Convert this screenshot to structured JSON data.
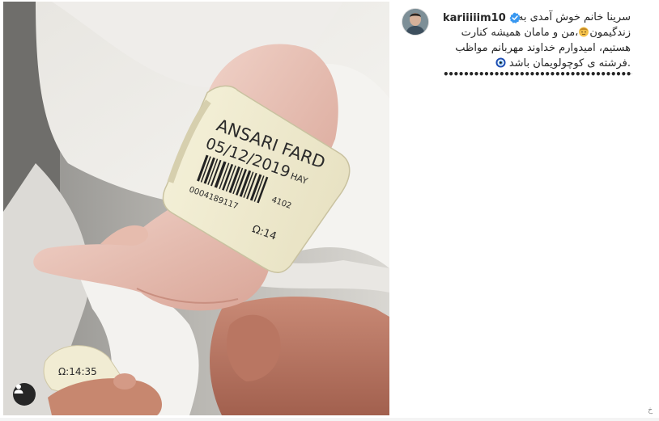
{
  "post": {
    "username": "kariiiiim10",
    "verified": true,
    "caption": {
      "line1": "سر‌ینا خانم خوش آمدی به",
      "line2": "زندگیمون",
      "line2b": "،من و مامان همیشه کنارت",
      "line3": "هستیم، امیدوارم خداوند مهربانم مواظب",
      "line4": ".فرشته ی کوچولویمان باشد",
      "dots": "••••••••••••••••••••••••••••••••••••••••••••••••••••••••••"
    },
    "resize_mark": "خ"
  },
  "photo": {
    "wristband_name": "ANSARI FARD",
    "wristband_date": "05/12/2019",
    "wristband_suffix": "HAY",
    "wristband_number": "0004189117",
    "wristband_side": "4102",
    "wristband_code": "Ω:14",
    "ankle_tag": "Ω:14:35"
  },
  "icons": {
    "user_tag": "user-silhouette-icon",
    "verified": "verified-badge-icon",
    "baby": "baby-emoji-icon",
    "nazar": "nazar-amulet-icon"
  },
  "colors": {
    "verified_blue": "#3897f0",
    "text": "#262626",
    "tag_button": "#262626"
  }
}
